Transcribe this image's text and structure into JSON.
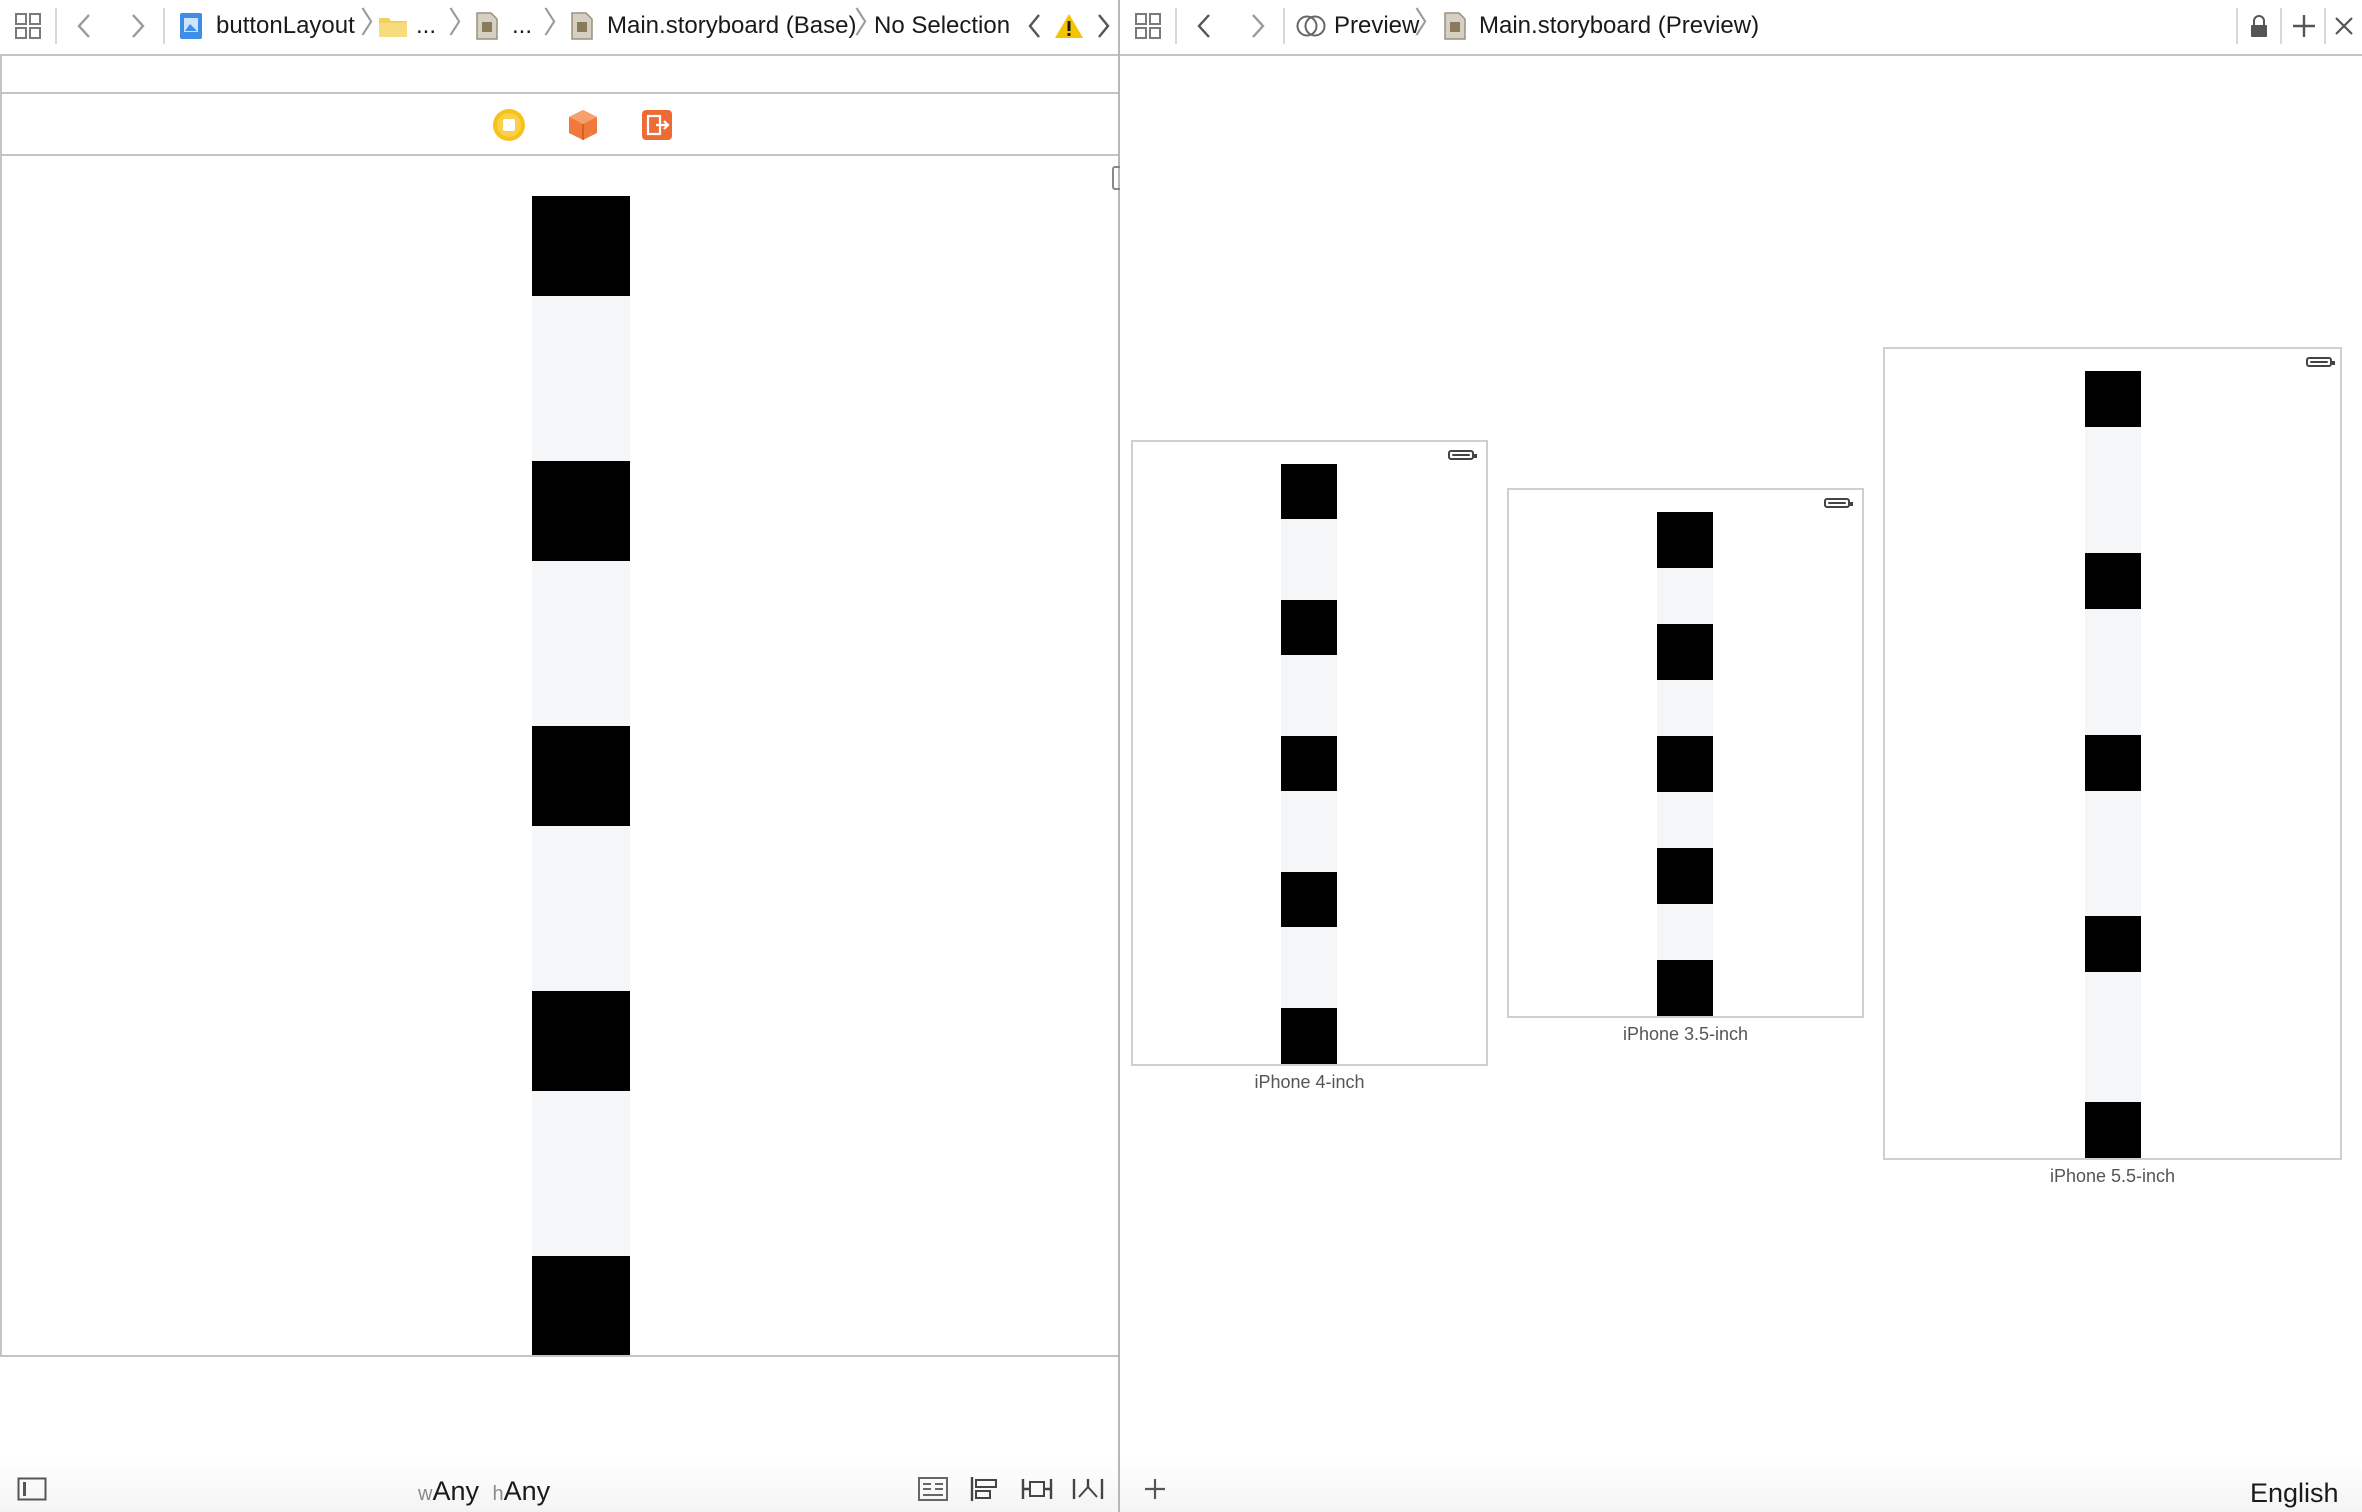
{
  "left_jump_bar": {
    "project": "buttonLayout",
    "folder_ellipsis": "...",
    "file_ellipsis": "...",
    "storyboard": "Main.storyboard (Base)",
    "selection": "No Selection"
  },
  "right_jump_bar": {
    "mode": "Preview",
    "storyboard": "Main.storyboard (Preview)"
  },
  "editor": {
    "stack_pattern": [
      "dark",
      "light",
      "dark",
      "light",
      "dark",
      "light",
      "dark",
      "light",
      "dark"
    ],
    "colors": {
      "dark": "#000000",
      "light": "#f4f6f8"
    }
  },
  "bottom_bar_left": {
    "width_prefix": "w",
    "width_value": "Any",
    "height_prefix": "h",
    "height_value": "Any"
  },
  "devices": [
    {
      "label": "iPhone 4-inch"
    },
    {
      "label": "iPhone 3.5-inch"
    },
    {
      "label": "iPhone 5.5-inch"
    }
  ],
  "bottom_bar_right": {
    "language": "English"
  },
  "icons": {
    "related_items": "grid-icon",
    "back": "chevron-left-icon",
    "forward": "chevron-right-icon",
    "warning": "warning-icon",
    "lock": "lock-icon",
    "add": "plus-icon",
    "close": "close-icon"
  }
}
